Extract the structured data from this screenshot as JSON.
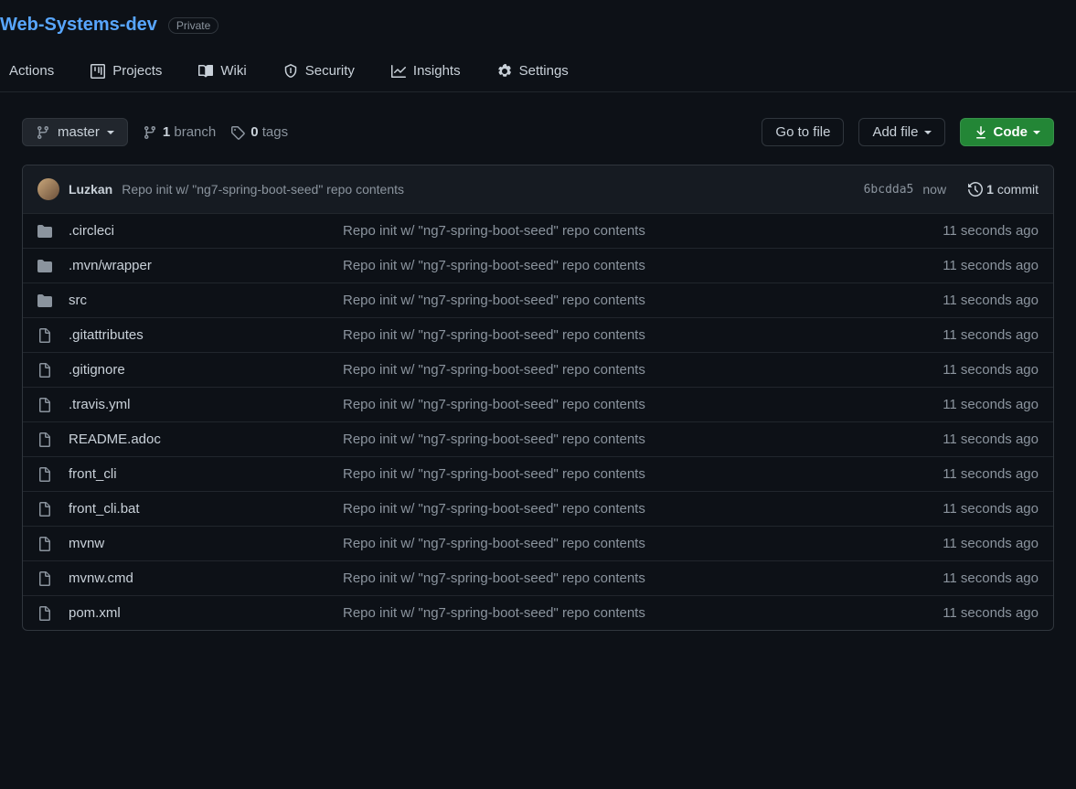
{
  "header": {
    "repo_name": "Web-Systems-dev",
    "privacy": "Private"
  },
  "tabs": [
    {
      "id": "actions",
      "label": "Actions",
      "icon": "play"
    },
    {
      "id": "projects",
      "label": "Projects",
      "icon": "project"
    },
    {
      "id": "wiki",
      "label": "Wiki",
      "icon": "book"
    },
    {
      "id": "security",
      "label": "Security",
      "icon": "shield"
    },
    {
      "id": "insights",
      "label": "Insights",
      "icon": "graph"
    },
    {
      "id": "settings",
      "label": "Settings",
      "icon": "gear"
    }
  ],
  "toolbar": {
    "branch": "master",
    "branches_count": "1",
    "branches_label": "branch",
    "tags_count": "0",
    "tags_label": "tags",
    "goto_file": "Go to file",
    "add_file": "Add file",
    "code": "Code"
  },
  "commit_bar": {
    "author": "Luzkan",
    "message": "Repo init w/ \"ng7-spring-boot-seed\" repo contents",
    "sha": "6bcdda5",
    "time": "now",
    "commits_count": "1",
    "commits_label": "commit"
  },
  "files": [
    {
      "type": "dir",
      "name": ".circleci",
      "msg": "Repo init w/ \"ng7-spring-boot-seed\" repo contents",
      "time": "11 seconds ago"
    },
    {
      "type": "dir",
      "name": ".mvn/wrapper",
      "msg": "Repo init w/ \"ng7-spring-boot-seed\" repo contents",
      "time": "11 seconds ago"
    },
    {
      "type": "dir",
      "name": "src",
      "msg": "Repo init w/ \"ng7-spring-boot-seed\" repo contents",
      "time": "11 seconds ago"
    },
    {
      "type": "file",
      "name": ".gitattributes",
      "msg": "Repo init w/ \"ng7-spring-boot-seed\" repo contents",
      "time": "11 seconds ago"
    },
    {
      "type": "file",
      "name": ".gitignore",
      "msg": "Repo init w/ \"ng7-spring-boot-seed\" repo contents",
      "time": "11 seconds ago"
    },
    {
      "type": "file",
      "name": ".travis.yml",
      "msg": "Repo init w/ \"ng7-spring-boot-seed\" repo contents",
      "time": "11 seconds ago"
    },
    {
      "type": "file",
      "name": "README.adoc",
      "msg": "Repo init w/ \"ng7-spring-boot-seed\" repo contents",
      "time": "11 seconds ago"
    },
    {
      "type": "file",
      "name": "front_cli",
      "msg": "Repo init w/ \"ng7-spring-boot-seed\" repo contents",
      "time": "11 seconds ago"
    },
    {
      "type": "file",
      "name": "front_cli.bat",
      "msg": "Repo init w/ \"ng7-spring-boot-seed\" repo contents",
      "time": "11 seconds ago"
    },
    {
      "type": "file",
      "name": "mvnw",
      "msg": "Repo init w/ \"ng7-spring-boot-seed\" repo contents",
      "time": "11 seconds ago"
    },
    {
      "type": "file",
      "name": "mvnw.cmd",
      "msg": "Repo init w/ \"ng7-spring-boot-seed\" repo contents",
      "time": "11 seconds ago"
    },
    {
      "type": "file",
      "name": "pom.xml",
      "msg": "Repo init w/ \"ng7-spring-boot-seed\" repo contents",
      "time": "11 seconds ago"
    }
  ]
}
